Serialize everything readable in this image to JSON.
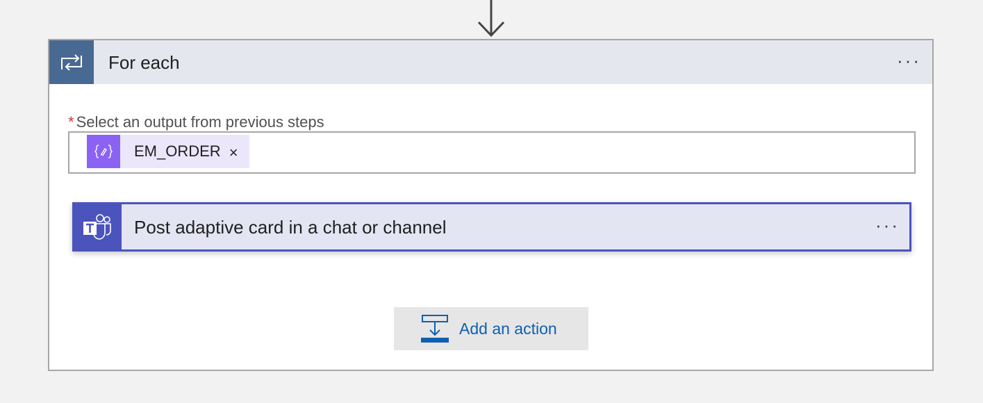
{
  "foreach": {
    "title": "For each",
    "menu_label": "···",
    "icon": "loop-icon",
    "header_color": "#e4e7ee",
    "icon_bg_color": "#486991"
  },
  "field": {
    "required_marker": "*",
    "label": "Select an output from previous steps",
    "token": {
      "text": "EM_ORDER",
      "remove_label": "×",
      "icon": "expression-icon",
      "icon_bg_color": "#8a63f5"
    }
  },
  "action": {
    "title": "Post adaptive card in a chat or channel",
    "menu_label": "···",
    "icon": "teams-icon",
    "accent_color": "#4b53bc"
  },
  "add_action": {
    "label": "Add an action",
    "icon": "add-action-icon",
    "color": "#0f5fb0"
  }
}
